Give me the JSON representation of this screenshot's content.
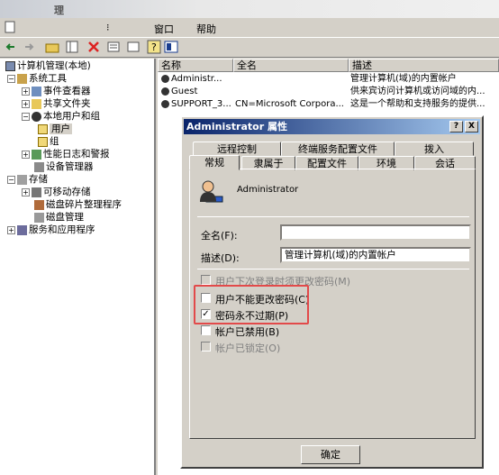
{
  "window": {
    "title": "理"
  },
  "menu": {
    "window": "窗口",
    "help": "帮助"
  },
  "tree": {
    "root": "计算机管理(本地)",
    "system_tools": "系统工具",
    "event_viewer": "事件查看器",
    "shared_folders": "共享文件夹",
    "local_users_groups": "本地用户和组",
    "users": "用户",
    "groups": "组",
    "perf_logs": "性能日志和警报",
    "device_manager": "设备管理器",
    "storage": "存储",
    "removable_storage": "可移动存储",
    "defrag": "磁盘碎片整理程序",
    "disk_mgmt": "磁盘管理",
    "services_apps": "服务和应用程序"
  },
  "list": {
    "headers": [
      "名称",
      "全名",
      "描述"
    ],
    "rows": [
      [
        "Administr...",
        "",
        "管理计算机(域)的内置帐户"
      ],
      [
        "Guest",
        "",
        "供来宾访问计算机或访问域的内..."
      ],
      [
        "SUPPORT_3...",
        "CN=Microsoft Corpora...",
        "这是一个帮助和支持服务的提供..."
      ]
    ]
  },
  "dialog": {
    "title": "Administrator 属性",
    "help_btn": "?",
    "close_btn": "X",
    "tabs_back": [
      "远程控制",
      "终端服务配置文件",
      "拨入"
    ],
    "tabs_front": [
      "常规",
      "隶属于",
      "配置文件",
      "环境",
      "会话"
    ],
    "username": "Administrator",
    "fullname_label": "全名(F):",
    "fullname_value": "",
    "desc_label": "描述(D):",
    "desc_value": "管理计算机(域)的内置帐户",
    "cb_must_change": "用户下次登录时须更改密码(M)",
    "cb_cannot_change": "用户不能更改密码(C)",
    "cb_never_expires": "密码永不过期(P)",
    "cb_disabled": "帐户已禁用(B)",
    "cb_locked": "帐户已锁定(O)",
    "check_mark": "✓",
    "ok": "确定"
  }
}
